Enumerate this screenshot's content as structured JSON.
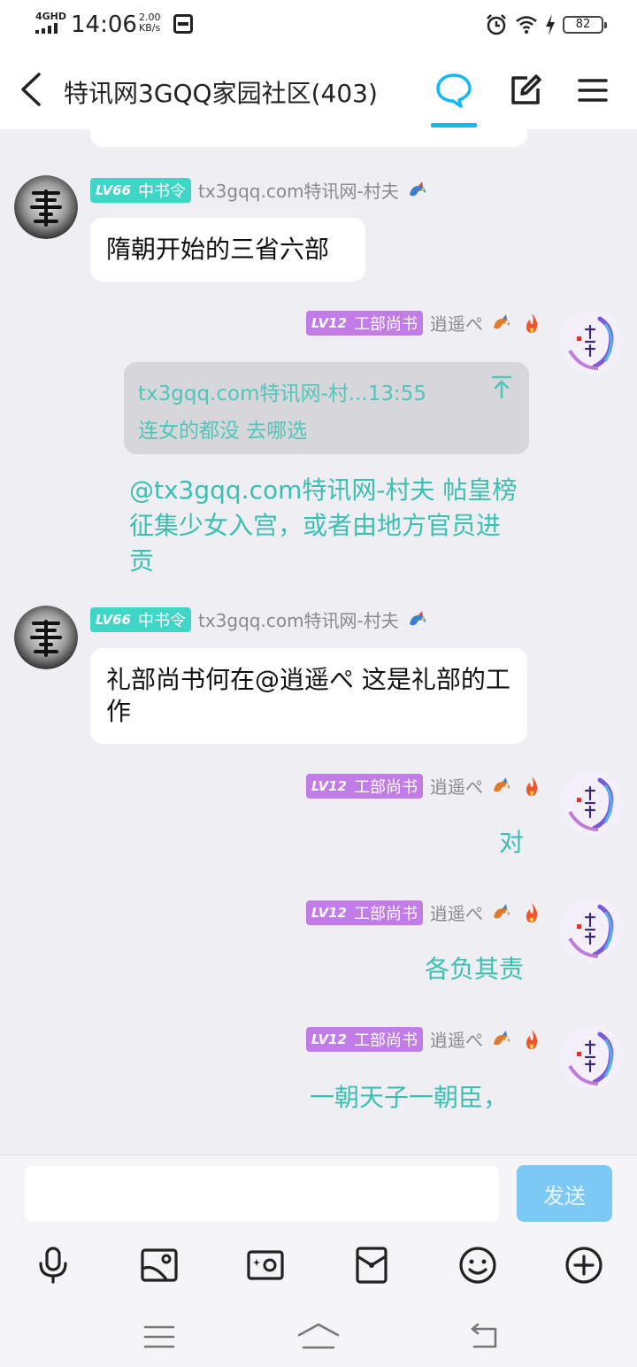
{
  "status_bar": {
    "network": "4GHD",
    "time": "14:06",
    "speed_value": "2.00",
    "speed_unit": "KB/s",
    "battery": "82"
  },
  "header": {
    "title": "特讯网3GQQ家园社区(403)"
  },
  "messages": {
    "m1": {
      "level": "LV66",
      "role": "中书令",
      "nick": "tx3gqq.com特讯网-村夫",
      "text": "隋朝开始的三省六部"
    },
    "m2": {
      "level": "LV12",
      "role": "工部尚书",
      "nick": "逍遥ぺ",
      "quote_header": "tx3gqq.com特讯网-村...13:55",
      "quote_text": "连女的都没  去哪选",
      "text": "@tx3gqq.com特讯网-村夫 帖皇榜征集少女入宫，或者由地方官员进贡"
    },
    "m3": {
      "level": "LV66",
      "role": "中书令",
      "nick": "tx3gqq.com特讯网-村夫",
      "text": "礼部尚书何在@逍遥ぺ 这是礼部的工作"
    },
    "m4": {
      "level": "LV12",
      "role": "工部尚书",
      "nick": "逍遥ぺ",
      "text": "对"
    },
    "m5": {
      "level": "LV12",
      "role": "工部尚书",
      "nick": "逍遥ぺ",
      "text": "各负其责"
    },
    "m6": {
      "level": "LV12",
      "role": "工部尚书",
      "nick": "逍遥ぺ",
      "text": "一朝天子一朝臣，"
    }
  },
  "input": {
    "value": "",
    "placeholder": "",
    "send_label": "发送"
  },
  "colors": {
    "accent": "#12b7f5",
    "teal_text": "#3bbfb1",
    "badge_teal": "#3fd6c8",
    "badge_purple": "#c27ce8",
    "send_button": "#7cc9f6"
  },
  "icons": {
    "header": [
      "back-icon",
      "chat-bubble-icon",
      "edit-icon",
      "menu-icon"
    ],
    "toolbar": [
      "microphone-icon",
      "image-icon",
      "camera-icon",
      "red-packet-icon",
      "emoji-icon",
      "plus-icon"
    ],
    "nav": [
      "recent-apps-icon",
      "home-icon",
      "back-nav-icon"
    ]
  }
}
